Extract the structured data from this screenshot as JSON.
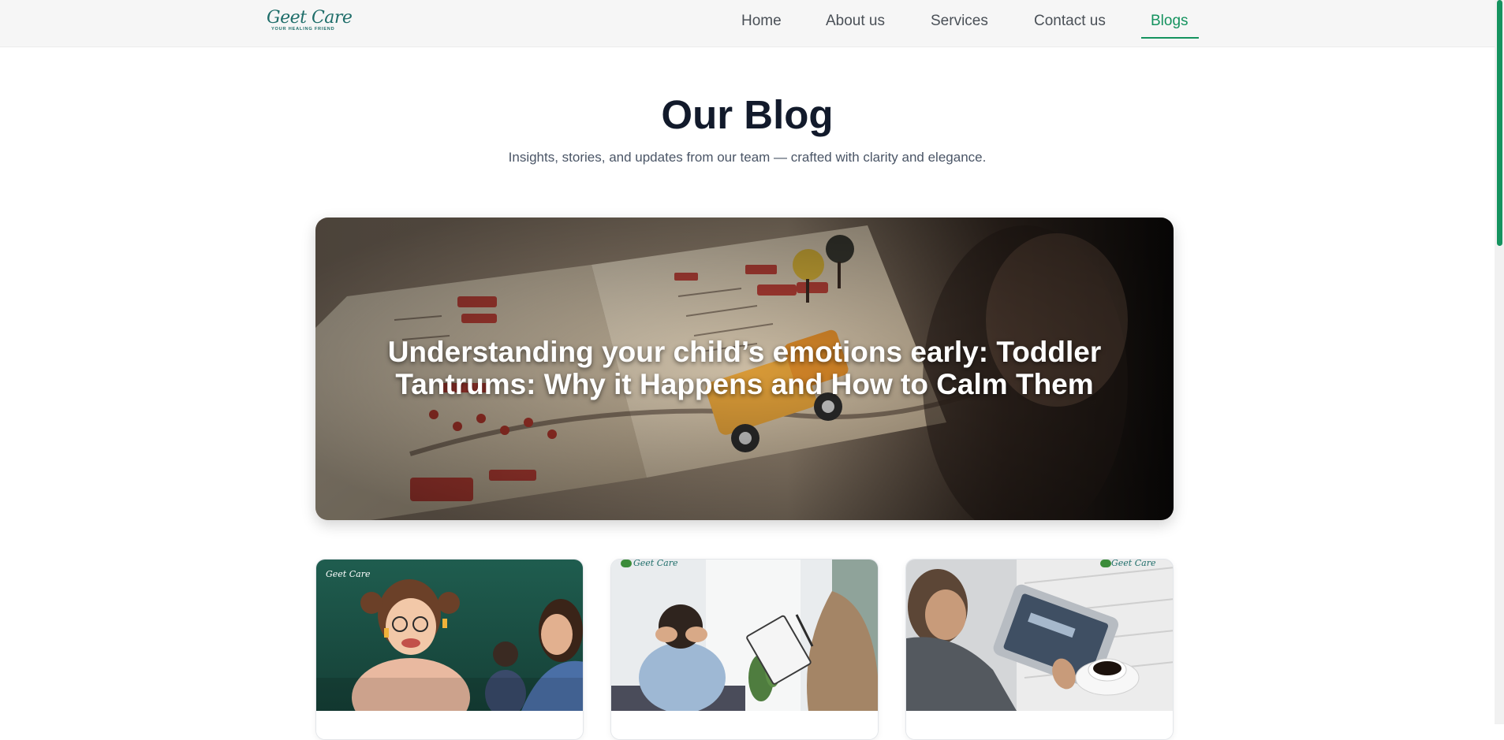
{
  "brand": {
    "logo_text": "Geet Care",
    "tagline": "YOUR HEALING FRIEND",
    "accent_color": "#15935f",
    "logo_color": "#1f6e6a"
  },
  "nav": {
    "items": [
      {
        "label": "Home"
      },
      {
        "label": "About us"
      },
      {
        "label": "Services"
      },
      {
        "label": "Contact us"
      },
      {
        "label": "Blogs",
        "active": true
      }
    ]
  },
  "header": {
    "title": "Our Blog",
    "subtitle": "Insights, stories, and updates from our team — crafted with clarity and elegance."
  },
  "featured": {
    "title": "Understanding your child’s emotions early: Toddler Tantrums: Why it Happens and How to Calm Them"
  },
  "cards": [
    {
      "logo_text": "Geet Care",
      "image": "girl-with-teacher-classroom"
    },
    {
      "logo_text": "Geet Care",
      "image": "stressed-man-with-therapist"
    },
    {
      "logo_text": "Geet Care",
      "image": "person-reading-tablet-coffee"
    }
  ]
}
